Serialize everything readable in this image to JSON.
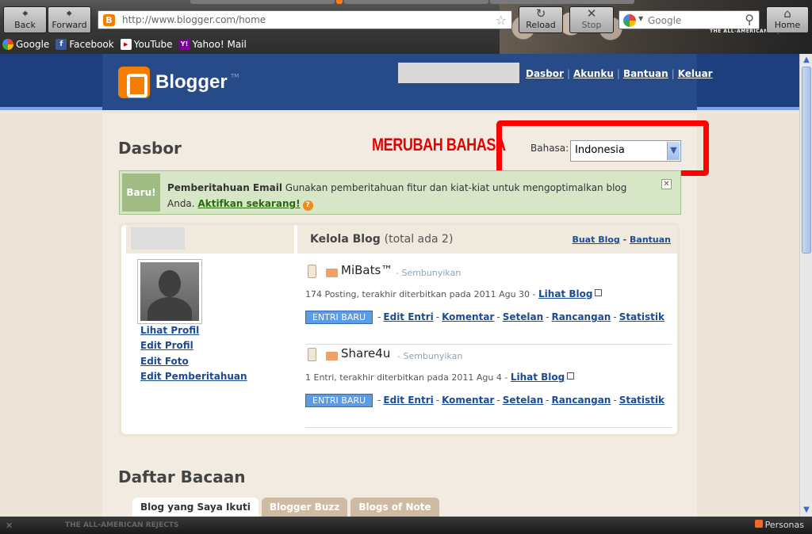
{
  "browser": {
    "back_label": "Back",
    "forward_label": "Forward",
    "reload_label": "Reload",
    "stop_label": "Stop",
    "home_label": "Home",
    "url": "http://www.blogger.com/home",
    "search_placeholder": "Google",
    "theme_label": "THE ALL-AMERICAN REJECTS",
    "bookmarks": [
      {
        "label": "Google",
        "icon": "google-icon"
      },
      {
        "label": "Facebook",
        "icon": "facebook-icon"
      },
      {
        "label": "YouTube",
        "icon": "youtube-icon"
      },
      {
        "label": "Yahoo! Mail",
        "icon": "yahoo-icon"
      }
    ]
  },
  "header": {
    "logo_text": "Blogger",
    "logo_tm": "TM",
    "links": {
      "dashboard": "Dasbor",
      "account": "Akunku",
      "help": "Bantuan",
      "logout": "Keluar"
    }
  },
  "dashboard": {
    "title": "Dasbor",
    "annotation": "MERUBAH BAHASA",
    "language_label": "Bahasa:",
    "language_value": "Indonesia"
  },
  "notice": {
    "badge": "Baru!",
    "title": "Pemberitahuan Email",
    "body": "Gunakan pemberitahuan fitur dan kiat-kiat untuk mengoptimalkan blog Anda.",
    "action": "Aktifkan sekarang!"
  },
  "profile": {
    "links": [
      "Lihat Profil",
      "Edit Profil",
      "Edit Foto",
      "Edit Pemberitahuan"
    ]
  },
  "blogs": {
    "title": "Kelola Blog",
    "count": "(total ada 2)",
    "create": "Buat Blog",
    "help": "Bantuan",
    "items": [
      {
        "name": "MiBats™",
        "hidden": "- Sembunyikan",
        "stats": "174 Posting, terakhir diterbitkan pada 2011 Agu 30 -",
        "view": "Lihat Blog",
        "new_post": "ENTRI BARU",
        "edit_posts": "Edit Entri",
        "comments": "Komentar",
        "settings": "Setelan",
        "design": "Rancangan",
        "stats_link": "Statistik"
      },
      {
        "name": "Share4u",
        "hidden": "- Sembunyikan",
        "stats": "1 Entri, terakhir diterbitkan pada 2011 Agu 4 -",
        "view": "Lihat Blog",
        "new_post": "ENTRI BARU",
        "edit_posts": "Edit Entri",
        "comments": "Komentar",
        "settings": "Setelan",
        "design": "Rancangan",
        "stats_link": "Statistik"
      }
    ]
  },
  "reading_list": {
    "title": "Daftar Bacaan",
    "tabs": [
      "Blog yang Saya Ikuti",
      "Blogger Buzz",
      "Blogs of Note"
    ]
  },
  "statusbar": {
    "theme_label": "THE ALL-AMERICAN REJECTS",
    "personas": "Personas"
  }
}
